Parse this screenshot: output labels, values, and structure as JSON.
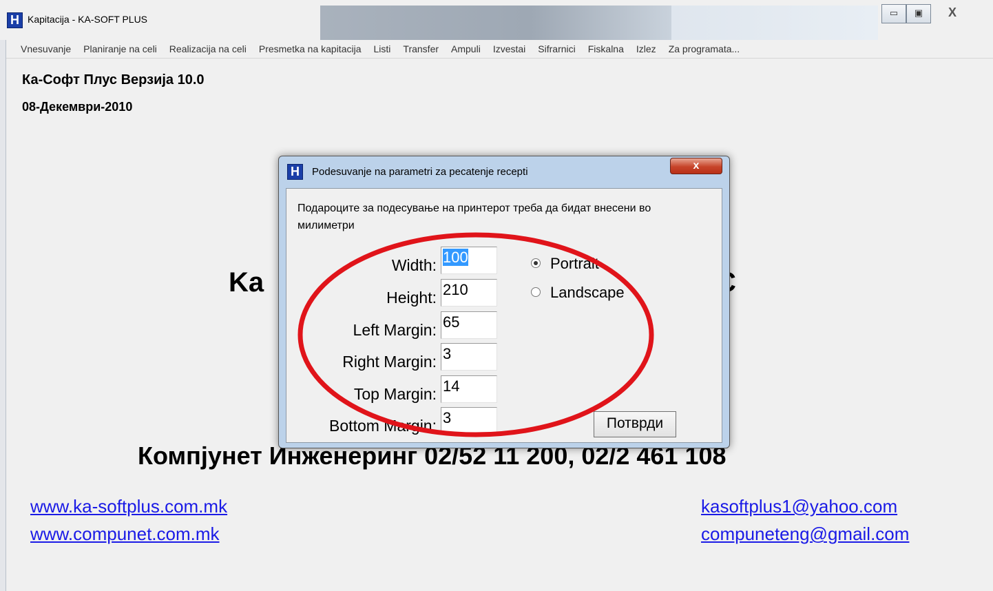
{
  "window": {
    "title": "Kapitacija - KA-SOFT PLUS",
    "app_icon_letter": "H",
    "controls": {
      "minimize": "▭",
      "maximize": "▣",
      "close": "X"
    }
  },
  "menubar": {
    "items": [
      "Vnesuvanje",
      "Planiranje na celi",
      "Realizacija na celi",
      "Presmetka na kapitacija",
      "Listi",
      "Transfer",
      "Ampuli",
      "Izvestai",
      "Sifrarnici",
      "Fiskalna",
      "Izlez",
      "Za programata..."
    ]
  },
  "main": {
    "version": "Ка-Софт Плус Верзија 10.0",
    "date": "08-Декември-2010",
    "big_title_left": "Ka",
    "big_title_right": "C",
    "company": "Компјунет Инженеринг 02/52 11 200, 02/2 461 108",
    "links": [
      "www.ka-softplus.com.mk",
      "www.compunet.com.mk",
      "kasoftplus1@yahoo.com",
      "compuneteng@gmail.com"
    ]
  },
  "dialog": {
    "title": "Podesuvanje na parametri za pecatenje recepti",
    "icon_letter": "H",
    "close_label": "x",
    "instructions": "Подароците за подесување на принтерот треба да бидат внесени во милиметри",
    "fields": [
      {
        "label": "Width:",
        "value": "100"
      },
      {
        "label": "Height:",
        "value": "210"
      },
      {
        "label": "Left Margin:",
        "value": "65"
      },
      {
        "label": "Right Margin:",
        "value": "3"
      },
      {
        "label": "Top Margin:",
        "value": "14"
      },
      {
        "label": "Bottom Margin:",
        "value": "3"
      }
    ],
    "orientation": {
      "options": [
        "Portrait",
        "Landscape"
      ],
      "selected": "Portrait"
    },
    "confirm_label": "Потврди"
  },
  "annotation": {
    "color": "#e0141a"
  }
}
